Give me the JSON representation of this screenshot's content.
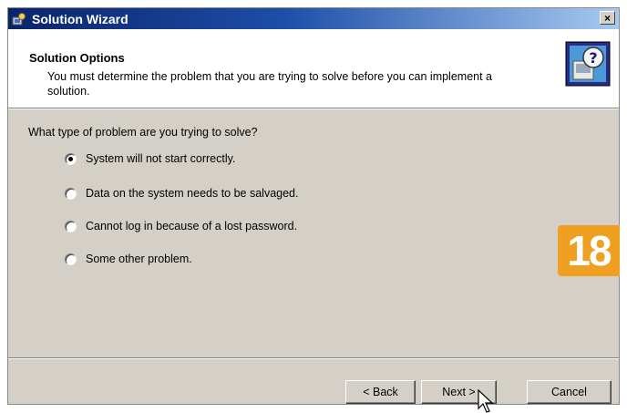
{
  "window": {
    "title": "Solution Wizard",
    "close_label": "×"
  },
  "header": {
    "title": "Solution Options",
    "description": "You must determine the problem that you are trying to solve before you can implement a solution."
  },
  "question": "What type of problem are you trying to solve?",
  "options": [
    {
      "label": "System will not start correctly.",
      "selected": true
    },
    {
      "label": "Data on the system needs to be salvaged.",
      "selected": false
    },
    {
      "label": "Cannot log in because of a lost password.",
      "selected": false
    },
    {
      "label": "Some other problem.",
      "selected": false
    }
  ],
  "badge": "18",
  "buttons": {
    "back": "< Back",
    "next": "Next >",
    "cancel": "Cancel"
  },
  "icons": {
    "title_icon": "wizard-icon",
    "header_graphic": "help-question-icon",
    "cursor": "mouse-pointer-icon"
  }
}
